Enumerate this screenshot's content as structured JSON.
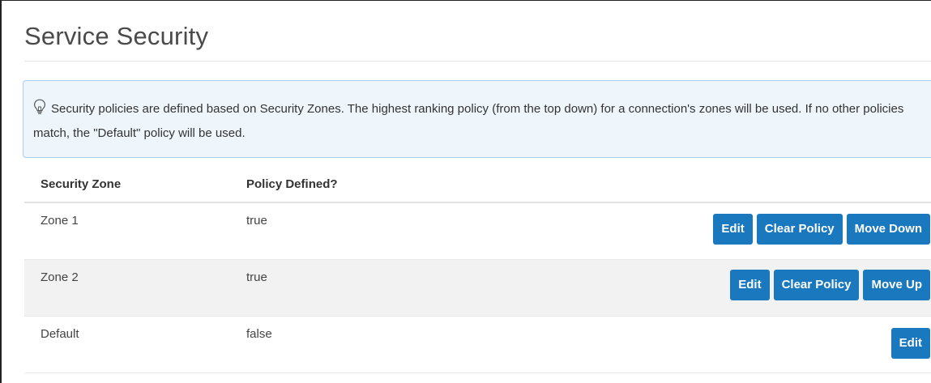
{
  "page": {
    "title": "Service Security"
  },
  "info": {
    "icon": "lightbulb-icon",
    "text": "Security policies are defined based on Security Zones. The highest ranking policy (from the top down) for a connection's zones will be used. If no other policies match, the \"Default\" policy will be used."
  },
  "table": {
    "columns": [
      "Security Zone",
      "Policy Defined?"
    ],
    "rows": [
      {
        "zone": "Zone 1",
        "policy": "true",
        "actions": [
          "Edit",
          "Clear Policy",
          "Move Down"
        ]
      },
      {
        "zone": "Zone 2",
        "policy": "true",
        "actions": [
          "Edit",
          "Clear Policy",
          "Move Up"
        ]
      },
      {
        "zone": "Default",
        "policy": "false",
        "actions": [
          "Edit"
        ]
      }
    ]
  },
  "colors": {
    "button": "#1a78bf",
    "info_bg": "#eef6fc",
    "info_border": "#a9cfe8",
    "stripe": "#f2f2f2"
  }
}
